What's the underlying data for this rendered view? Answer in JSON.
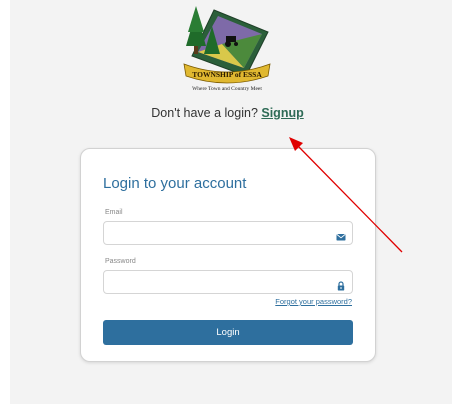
{
  "logo": {
    "name": "TOWNSHIP of ESSA",
    "tagline": "Where Town and Country Meet"
  },
  "signup": {
    "prompt": "Don't have a login? ",
    "link_label": "Signup"
  },
  "card": {
    "title": "Login to your account",
    "email": {
      "label": "Email",
      "value": "",
      "placeholder": "",
      "icon": "envelope-icon"
    },
    "password": {
      "label": "Password",
      "value": "",
      "placeholder": "",
      "icon": "lock-icon"
    },
    "forgot_label": "Forgot your password?",
    "login_label": "Login"
  },
  "colors": {
    "accent": "#2e6f9e",
    "signup_link": "#2e6b56",
    "annotation_arrow": "#e00000"
  }
}
